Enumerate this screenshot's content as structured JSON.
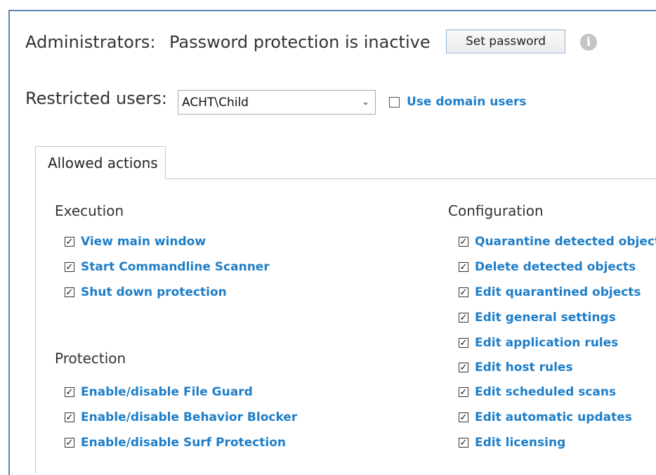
{
  "administrators": {
    "label": "Administrators:",
    "status": "Password protection is inactive",
    "set_password_button": "Set password",
    "info_icon": "info-icon",
    "info_glyph": "i"
  },
  "restricted_users": {
    "label": "Restricted users:",
    "selected_user": "ACHT\\Child",
    "caret_glyph": "⌄",
    "use_domain_users": {
      "label": "Use domain users",
      "checked": false
    }
  },
  "tabs": [
    {
      "label": "Allowed actions",
      "active": true
    }
  ],
  "groups": {
    "execution": {
      "title": "Execution",
      "items": [
        {
          "label": "View main window",
          "checked": true
        },
        {
          "label": "Start Commandline Scanner",
          "checked": true
        },
        {
          "label": "Shut down protection",
          "checked": true
        }
      ]
    },
    "protection": {
      "title": "Protection",
      "items": [
        {
          "label": "Enable/disable File Guard",
          "checked": true
        },
        {
          "label": "Enable/disable Behavior Blocker",
          "checked": true
        },
        {
          "label": "Enable/disable Surf Protection",
          "checked": true
        }
      ]
    },
    "configuration": {
      "title": "Configuration",
      "items": [
        {
          "label": "Quarantine detected objects",
          "checked": true
        },
        {
          "label": "Delete detected objects",
          "checked": true
        },
        {
          "label": "Edit quarantined objects",
          "checked": true
        },
        {
          "label": "Edit general settings",
          "checked": true
        },
        {
          "label": "Edit application rules",
          "checked": true
        },
        {
          "label": "Edit host rules",
          "checked": true
        },
        {
          "label": "Edit scheduled scans",
          "checked": true
        },
        {
          "label": "Edit automatic updates",
          "checked": true
        },
        {
          "label": "Edit licensing",
          "checked": true
        }
      ]
    }
  },
  "check_glyph": "✓",
  "colors": {
    "accent_link": "#1e7ec8",
    "frame_border": "#5f86b3",
    "text": "#333333"
  }
}
